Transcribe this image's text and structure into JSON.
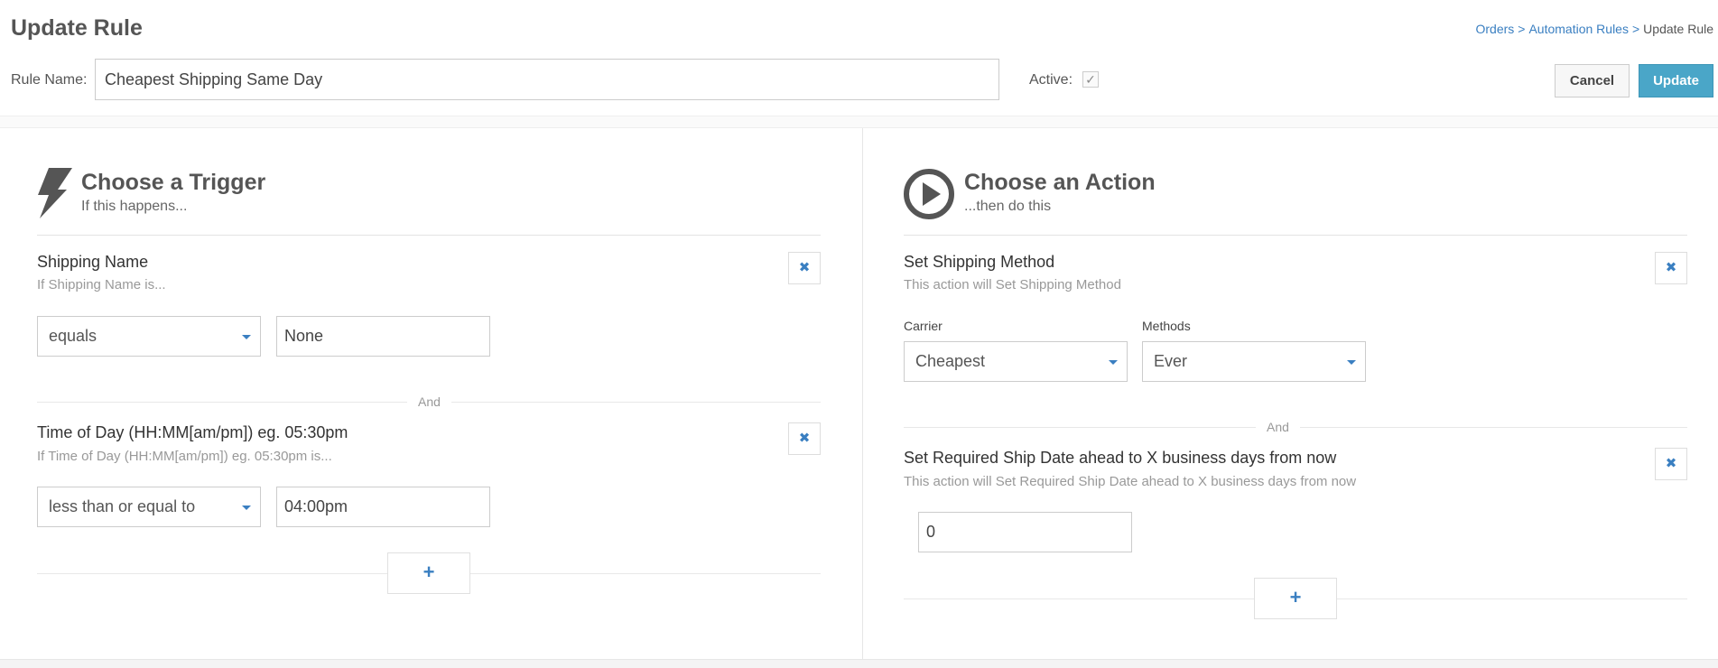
{
  "header": {
    "title": "Update Rule",
    "breadcrumb": {
      "orders": "Orders",
      "sep": ">",
      "rules": "Automation Rules",
      "current": "Update Rule"
    },
    "rule_name_label": "Rule Name:",
    "rule_name_value": "Cheapest Shipping Same Day",
    "active_label": "Active:",
    "active_checked": true,
    "cancel_label": "Cancel",
    "update_label": "Update"
  },
  "trigger": {
    "title": "Choose a Trigger",
    "subtitle": "If this happens...",
    "icon": "lightning-icon",
    "conditions": [
      {
        "title": "Shipping Name",
        "desc": "If Shipping Name is...",
        "operator": "equals",
        "value": "None"
      },
      {
        "title": "Time of Day (HH:MM[am/pm]) eg. 05:30pm",
        "desc": "If Time of Day (HH:MM[am/pm]) eg. 05:30pm is...",
        "operator": "less than or equal to",
        "value": "04:00pm"
      }
    ],
    "and_label": "And",
    "add_label": "+"
  },
  "action": {
    "title": "Choose an Action",
    "subtitle": "...then do this",
    "icon": "play-circle-icon",
    "actions": [
      {
        "title": "Set Shipping Method",
        "desc": "This action will Set Shipping Method",
        "carrier_label": "Carrier",
        "carrier_value": "Cheapest",
        "methods_label": "Methods",
        "methods_value": "Ever"
      },
      {
        "title": "Set Required Ship Date ahead to X business days from now",
        "desc": "This action will Set Required Ship Date ahead to X business days from now",
        "value": "0"
      }
    ],
    "and_label": "And",
    "add_label": "+"
  },
  "colors": {
    "accent": "#3a7fc1",
    "update_button": "#4aa6c8"
  }
}
